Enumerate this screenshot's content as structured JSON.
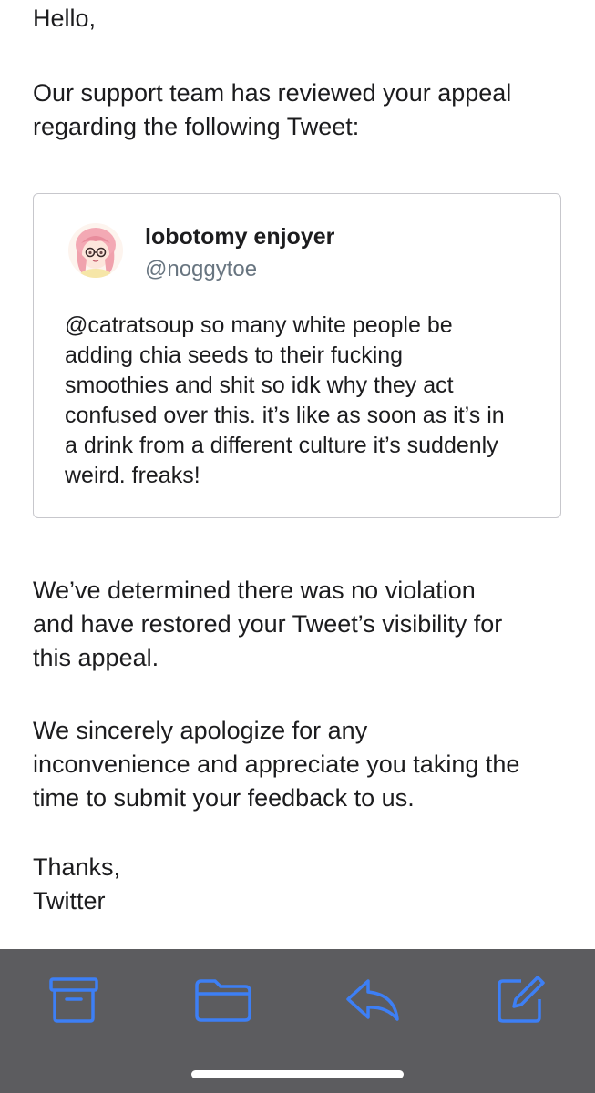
{
  "email": {
    "greeting": "Hello,",
    "intro_lines": [
      "Our support team has reviewed your appeal",
      "regarding the following Tweet:"
    ],
    "determined_lines": [
      "We’ve determined there was no violation",
      "and have restored your Tweet’s visibility for",
      "this appeal."
    ],
    "apology_lines": [
      "We sincerely apologize for any",
      "inconvenience and appreciate you taking the",
      "time to submit your feedback to us."
    ],
    "signoff": "Thanks,",
    "sender": "Twitter"
  },
  "tweet": {
    "display_name": "lobotomy enjoyer",
    "handle": "@noggytoe",
    "text_lines": [
      "@catratsoup so many white people be",
      "adding chia seeds to their fucking",
      "smoothies and shit so idk why they act",
      "confused over this. it’s like as soon as it’s in",
      "a drink from a different culture it’s suddenly",
      "weird. freaks!"
    ]
  },
  "toolbar": {
    "icons": [
      "archive-icon",
      "folder-icon",
      "reply-icon",
      "compose-icon"
    ],
    "accent_color": "#3d7ff5",
    "background_color": "#5c5c5f"
  }
}
